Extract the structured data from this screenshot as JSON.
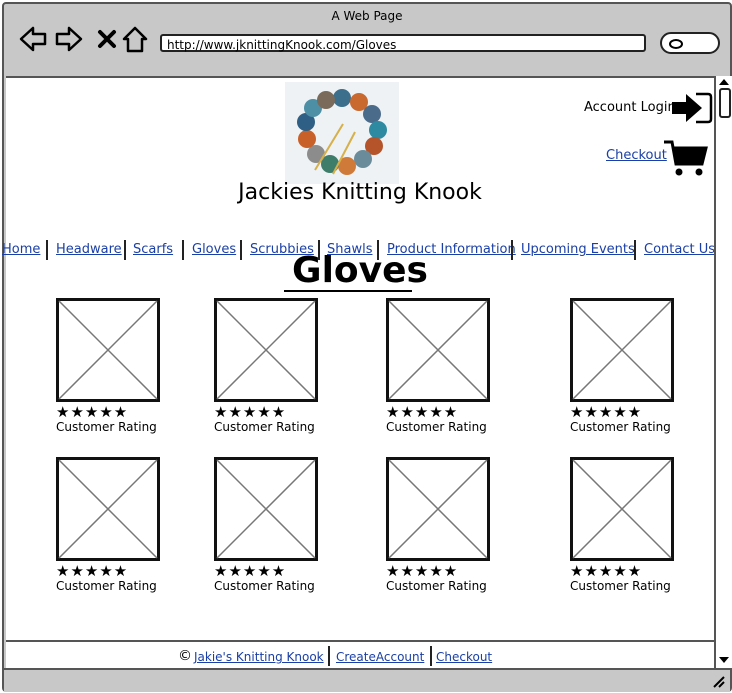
{
  "window": {
    "title": "A Web Page",
    "url": "http://www.jknittingKnook.com/Gloves"
  },
  "header": {
    "site_title": "Jackies Knitting Knook",
    "account_login": "Account Login",
    "checkout": "Checkout"
  },
  "nav": {
    "items": [
      {
        "label": "Home"
      },
      {
        "label": "Headware"
      },
      {
        "label": "Scarfs"
      },
      {
        "label": "Gloves"
      },
      {
        "label": "Scrubbies"
      },
      {
        "label": "Shawls"
      },
      {
        "label": "Product Information"
      },
      {
        "label": "Upcoming Events"
      },
      {
        "label": "Contact Us"
      }
    ]
  },
  "main": {
    "heading": "Gloves",
    "products": [
      {
        "stars": "★★★★★",
        "rating_label": "Customer Rating"
      },
      {
        "stars": "★★★★★",
        "rating_label": "Customer Rating"
      },
      {
        "stars": "★★★★★",
        "rating_label": "Customer Rating"
      },
      {
        "stars": "★★★★★",
        "rating_label": "Customer Rating"
      },
      {
        "stars": "★★★★★",
        "rating_label": "Customer Rating"
      },
      {
        "stars": "★★★★★",
        "rating_label": "Customer Rating"
      },
      {
        "stars": "★★★★★",
        "rating_label": "Customer Rating"
      },
      {
        "stars": "★★★★★",
        "rating_label": "Customer Rating"
      }
    ]
  },
  "footer": {
    "copyright_symbol": "©",
    "links": [
      {
        "label": "Jakie's Knitting Knook"
      },
      {
        "label": "CreateAccount"
      },
      {
        "label": "Checkout"
      }
    ]
  },
  "colors": {
    "link": "#1a3fa6",
    "chrome": "#c8c8c8"
  }
}
